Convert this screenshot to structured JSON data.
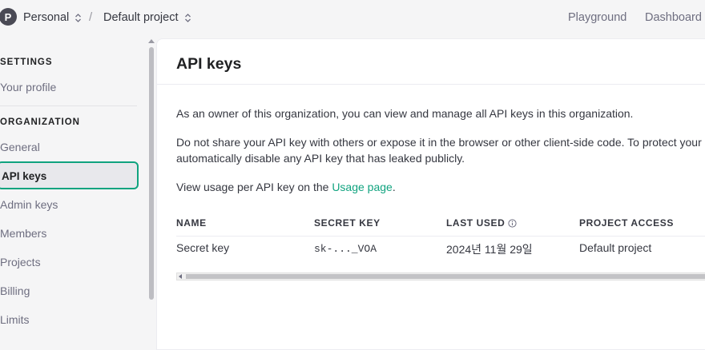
{
  "header": {
    "avatar_letter": "P",
    "org": "Personal",
    "separator": "/",
    "project": "Default project",
    "nav": [
      "Playground",
      "Dashboard"
    ]
  },
  "sidebar": {
    "settings_title": "SETTINGS",
    "settings_items": [
      "Your profile"
    ],
    "org_title": "ORGANIZATION",
    "org_items": [
      "General",
      "API keys",
      "Admin keys",
      "Members",
      "Projects",
      "Billing",
      "Limits"
    ],
    "active_item": "API keys"
  },
  "main": {
    "title": "API keys",
    "para1": "As an owner of this organization, you can view and manage all API keys in this organization.",
    "para2_line1": "Do not share your API key with others or expose it in the browser or other client-side code. To protect your a",
    "para2_line2": "automatically disable any API key that has leaked publicly.",
    "para3_prefix": "View usage per API key on the ",
    "para3_link": "Usage page",
    "para3_suffix": ".",
    "table": {
      "headers": [
        "NAME",
        "SECRET KEY",
        "LAST USED",
        "PROJECT ACCESS"
      ],
      "rows": [
        [
          "Secret key",
          "sk-..._VOA",
          "2024년 11월 29일",
          "Default project"
        ]
      ]
    }
  },
  "icons": {
    "chevron": "chevron-up-down-icon",
    "info": "info-circle-icon"
  },
  "colors": {
    "accent": "#10a37f"
  }
}
